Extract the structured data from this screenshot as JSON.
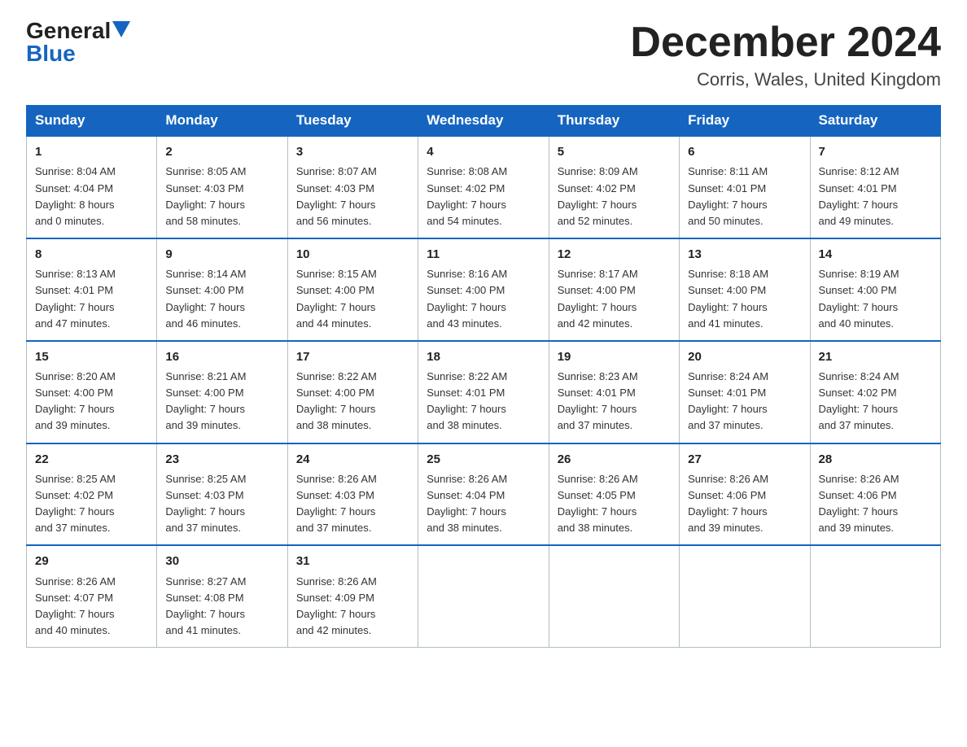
{
  "header": {
    "logo_general": "General",
    "logo_blue": "Blue",
    "month_title": "December 2024",
    "location": "Corris, Wales, United Kingdom"
  },
  "days_of_week": [
    "Sunday",
    "Monday",
    "Tuesday",
    "Wednesday",
    "Thursday",
    "Friday",
    "Saturday"
  ],
  "weeks": [
    [
      {
        "day": "1",
        "info": "Sunrise: 8:04 AM\nSunset: 4:04 PM\nDaylight: 8 hours\nand 0 minutes."
      },
      {
        "day": "2",
        "info": "Sunrise: 8:05 AM\nSunset: 4:03 PM\nDaylight: 7 hours\nand 58 minutes."
      },
      {
        "day": "3",
        "info": "Sunrise: 8:07 AM\nSunset: 4:03 PM\nDaylight: 7 hours\nand 56 minutes."
      },
      {
        "day": "4",
        "info": "Sunrise: 8:08 AM\nSunset: 4:02 PM\nDaylight: 7 hours\nand 54 minutes."
      },
      {
        "day": "5",
        "info": "Sunrise: 8:09 AM\nSunset: 4:02 PM\nDaylight: 7 hours\nand 52 minutes."
      },
      {
        "day": "6",
        "info": "Sunrise: 8:11 AM\nSunset: 4:01 PM\nDaylight: 7 hours\nand 50 minutes."
      },
      {
        "day": "7",
        "info": "Sunrise: 8:12 AM\nSunset: 4:01 PM\nDaylight: 7 hours\nand 49 minutes."
      }
    ],
    [
      {
        "day": "8",
        "info": "Sunrise: 8:13 AM\nSunset: 4:01 PM\nDaylight: 7 hours\nand 47 minutes."
      },
      {
        "day": "9",
        "info": "Sunrise: 8:14 AM\nSunset: 4:00 PM\nDaylight: 7 hours\nand 46 minutes."
      },
      {
        "day": "10",
        "info": "Sunrise: 8:15 AM\nSunset: 4:00 PM\nDaylight: 7 hours\nand 44 minutes."
      },
      {
        "day": "11",
        "info": "Sunrise: 8:16 AM\nSunset: 4:00 PM\nDaylight: 7 hours\nand 43 minutes."
      },
      {
        "day": "12",
        "info": "Sunrise: 8:17 AM\nSunset: 4:00 PM\nDaylight: 7 hours\nand 42 minutes."
      },
      {
        "day": "13",
        "info": "Sunrise: 8:18 AM\nSunset: 4:00 PM\nDaylight: 7 hours\nand 41 minutes."
      },
      {
        "day": "14",
        "info": "Sunrise: 8:19 AM\nSunset: 4:00 PM\nDaylight: 7 hours\nand 40 minutes."
      }
    ],
    [
      {
        "day": "15",
        "info": "Sunrise: 8:20 AM\nSunset: 4:00 PM\nDaylight: 7 hours\nand 39 minutes."
      },
      {
        "day": "16",
        "info": "Sunrise: 8:21 AM\nSunset: 4:00 PM\nDaylight: 7 hours\nand 39 minutes."
      },
      {
        "day": "17",
        "info": "Sunrise: 8:22 AM\nSunset: 4:00 PM\nDaylight: 7 hours\nand 38 minutes."
      },
      {
        "day": "18",
        "info": "Sunrise: 8:22 AM\nSunset: 4:01 PM\nDaylight: 7 hours\nand 38 minutes."
      },
      {
        "day": "19",
        "info": "Sunrise: 8:23 AM\nSunset: 4:01 PM\nDaylight: 7 hours\nand 37 minutes."
      },
      {
        "day": "20",
        "info": "Sunrise: 8:24 AM\nSunset: 4:01 PM\nDaylight: 7 hours\nand 37 minutes."
      },
      {
        "day": "21",
        "info": "Sunrise: 8:24 AM\nSunset: 4:02 PM\nDaylight: 7 hours\nand 37 minutes."
      }
    ],
    [
      {
        "day": "22",
        "info": "Sunrise: 8:25 AM\nSunset: 4:02 PM\nDaylight: 7 hours\nand 37 minutes."
      },
      {
        "day": "23",
        "info": "Sunrise: 8:25 AM\nSunset: 4:03 PM\nDaylight: 7 hours\nand 37 minutes."
      },
      {
        "day": "24",
        "info": "Sunrise: 8:26 AM\nSunset: 4:03 PM\nDaylight: 7 hours\nand 37 minutes."
      },
      {
        "day": "25",
        "info": "Sunrise: 8:26 AM\nSunset: 4:04 PM\nDaylight: 7 hours\nand 38 minutes."
      },
      {
        "day": "26",
        "info": "Sunrise: 8:26 AM\nSunset: 4:05 PM\nDaylight: 7 hours\nand 38 minutes."
      },
      {
        "day": "27",
        "info": "Sunrise: 8:26 AM\nSunset: 4:06 PM\nDaylight: 7 hours\nand 39 minutes."
      },
      {
        "day": "28",
        "info": "Sunrise: 8:26 AM\nSunset: 4:06 PM\nDaylight: 7 hours\nand 39 minutes."
      }
    ],
    [
      {
        "day": "29",
        "info": "Sunrise: 8:26 AM\nSunset: 4:07 PM\nDaylight: 7 hours\nand 40 minutes."
      },
      {
        "day": "30",
        "info": "Sunrise: 8:27 AM\nSunset: 4:08 PM\nDaylight: 7 hours\nand 41 minutes."
      },
      {
        "day": "31",
        "info": "Sunrise: 8:26 AM\nSunset: 4:09 PM\nDaylight: 7 hours\nand 42 minutes."
      },
      null,
      null,
      null,
      null
    ]
  ]
}
